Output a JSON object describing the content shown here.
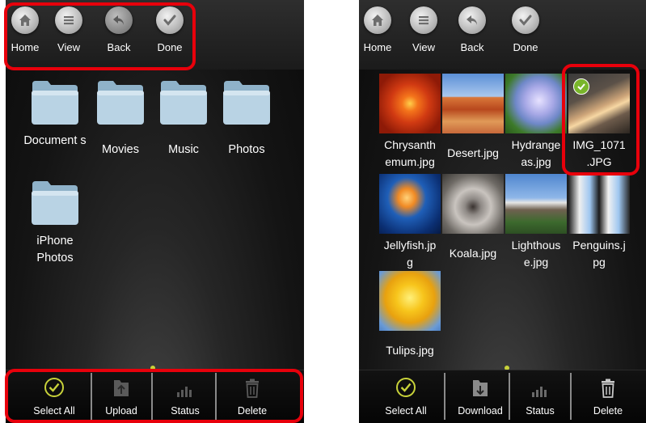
{
  "left": {
    "toolbar": [
      {
        "label": "Home",
        "icon": "home-icon"
      },
      {
        "label": "View",
        "icon": "list-icon"
      },
      {
        "label": "Back",
        "icon": "back-arrow-icon"
      },
      {
        "label": "Done",
        "icon": "checkmark-icon"
      }
    ],
    "folders": [
      {
        "label": "Document s"
      },
      {
        "label": "Movies"
      },
      {
        "label": "Music"
      },
      {
        "label": "Photos"
      },
      {
        "label": "iPhone Photos"
      }
    ],
    "bottom": [
      {
        "label": "Select All",
        "icon": "select-all-check-icon"
      },
      {
        "label": "Upload",
        "icon": "upload-icon"
      },
      {
        "label": "Status",
        "icon": "status-bars-icon"
      },
      {
        "label": "Delete",
        "icon": "trash-icon"
      }
    ]
  },
  "right": {
    "toolbar": [
      {
        "label": "Home",
        "icon": "home-icon"
      },
      {
        "label": "View",
        "icon": "list-icon"
      },
      {
        "label": "Back",
        "icon": "back-arrow-icon"
      },
      {
        "label": "Done",
        "icon": "checkmark-icon"
      }
    ],
    "images": [
      {
        "name": "Chrysanth emum.jpg",
        "selected": false
      },
      {
        "name": "Desert.jpg",
        "selected": false
      },
      {
        "name": "Hydrange as.jpg",
        "selected": false
      },
      {
        "name": "IMG_1071 .JPG",
        "selected": true
      },
      {
        "name": "Jellyfish.jp g",
        "selected": false
      },
      {
        "name": "Koala.jpg",
        "selected": false
      },
      {
        "name": "Lighthous e.jpg",
        "selected": false
      },
      {
        "name": "Penguins.j pg",
        "selected": false
      },
      {
        "name": "Tulips.jpg",
        "selected": false
      }
    ],
    "bottom": [
      {
        "label": "Select All",
        "icon": "select-all-check-icon"
      },
      {
        "label": "Download",
        "icon": "download-icon"
      },
      {
        "label": "Status",
        "icon": "status-bars-icon"
      },
      {
        "label": "Delete",
        "icon": "trash-icon"
      }
    ]
  },
  "colors": {
    "highlight": "#e8000b",
    "accent_green": "#c8d23a",
    "selected_badge": "#79b52a"
  }
}
